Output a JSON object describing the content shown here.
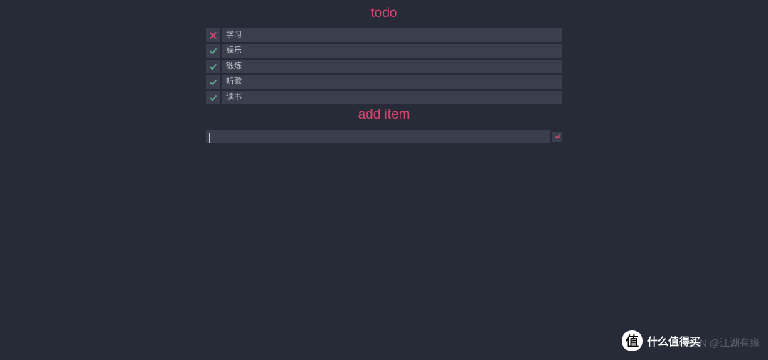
{
  "headings": {
    "todo": "todo",
    "add": "add item"
  },
  "items": [
    {
      "label": "学习",
      "done": false
    },
    {
      "label": "娱乐",
      "done": true
    },
    {
      "label": "锻炼",
      "done": true
    },
    {
      "label": "听歌",
      "done": true
    },
    {
      "label": "读书",
      "done": true
    }
  ],
  "input": {
    "value": ""
  },
  "icons": {
    "x_color": "#d6456e",
    "check_color": "#5faf8f",
    "enter_color": "#d6456e"
  },
  "watermarks": {
    "zhi_badge": "值",
    "zhi_text": "什么值得买",
    "csdn": "CSDN @江湖有缘"
  }
}
